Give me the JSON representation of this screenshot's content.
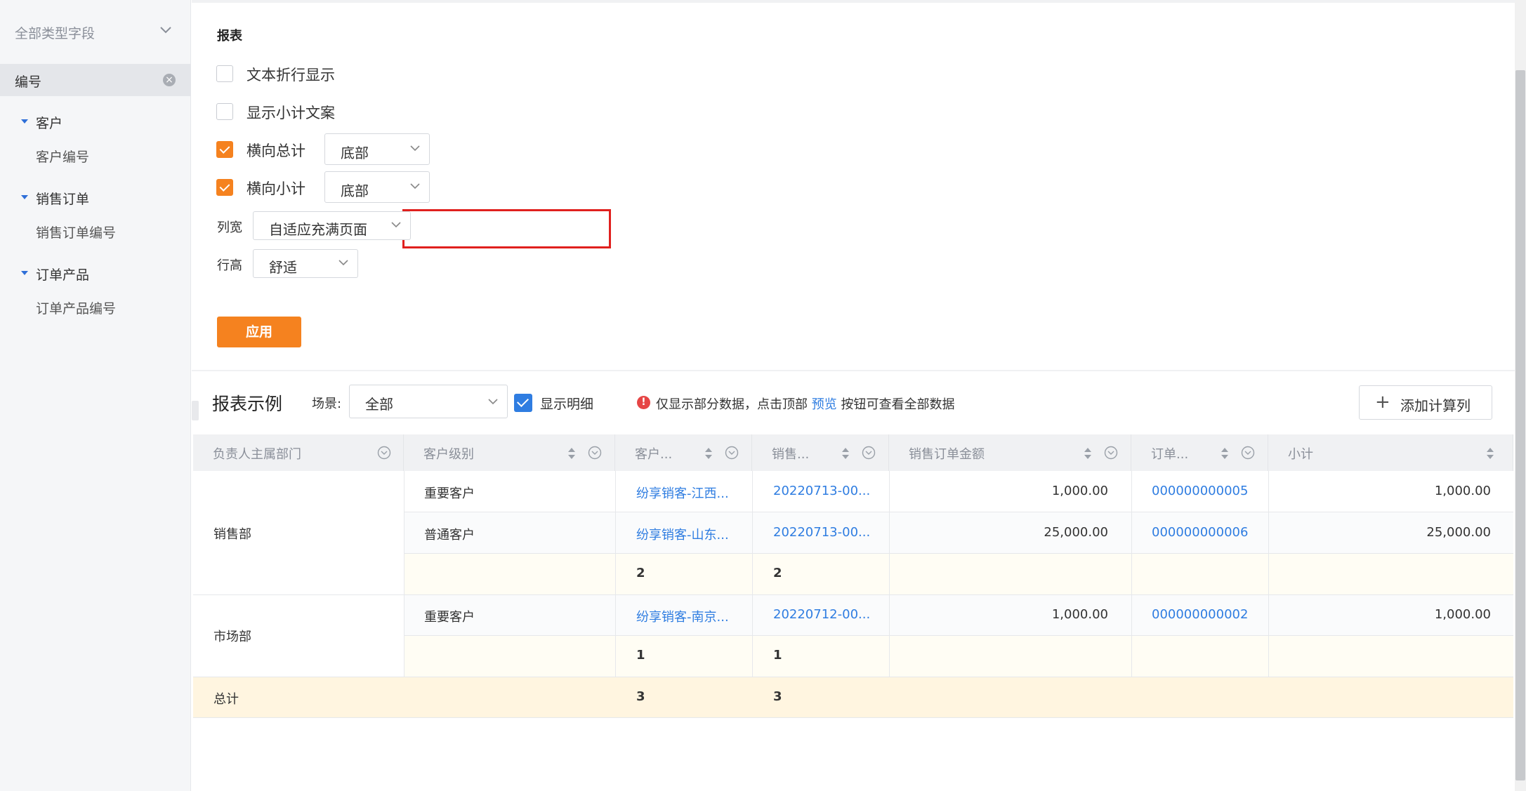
{
  "sidebar": {
    "type_select": "全部类型字段",
    "selected_field": "编号",
    "groups": [
      {
        "label": "客户",
        "items": [
          "客户编号"
        ]
      },
      {
        "label": "销售订单",
        "items": [
          "销售订单编号"
        ]
      },
      {
        "label": "订单产品",
        "items": [
          "订单产品编号"
        ]
      }
    ]
  },
  "settings": {
    "title": "报表",
    "wrap_text": {
      "label": "文本折行显示",
      "checked": false
    },
    "show_subtotal_text": {
      "label": "显示小计文案",
      "checked": false
    },
    "horizontal_total": {
      "label": "横向总计",
      "checked": true,
      "value": "底部"
    },
    "horizontal_subtotal": {
      "label": "横向小计",
      "checked": true,
      "value": "底部"
    },
    "column_width": {
      "label": "列宽",
      "value": "自适应充满页面"
    },
    "row_height": {
      "label": "行高",
      "value": "舒适"
    },
    "apply_label": "应用"
  },
  "report": {
    "title": "报表示例",
    "scene_label": "场景:",
    "scene_value": "全部",
    "show_detail_label": "显示明细",
    "info_prefix": "仅显示部分数据，点击顶部",
    "info_link": "预览",
    "info_suffix": "按钮可查看全部数据",
    "add_column_label": "添加计算列",
    "columns": [
      "负责人主属部门",
      "客户级别",
      "客户...",
      "销售...",
      "销售订单金额",
      "订单...",
      "小计"
    ],
    "rows": [
      {
        "dept": "销售部",
        "level": "重要客户",
        "customer": "纷享销客-江西...",
        "order": "20220713-00...",
        "amount": "1,000.00",
        "product": "000000000005",
        "subtotal": "1,000.00"
      },
      {
        "dept": "",
        "level": "普通客户",
        "customer": "纷享销客-山东...",
        "order": "20220713-00...",
        "amount": "25,000.00",
        "product": "000000000006",
        "subtotal": "25,000.00"
      },
      {
        "dept": "",
        "level": "",
        "customer": "2",
        "order": "2",
        "amount": "",
        "product": "",
        "subtotal": ""
      },
      {
        "dept": "市场部",
        "level": "重要客户",
        "customer": "纷享销客-南京...",
        "order": "20220712-00...",
        "amount": "1,000.00",
        "product": "000000000002",
        "subtotal": "1,000.00"
      },
      {
        "dept": "",
        "level": "",
        "customer": "1",
        "order": "1",
        "amount": "",
        "product": "",
        "subtotal": ""
      }
    ],
    "total": {
      "label": "总计",
      "customer": "3",
      "order": "3"
    }
  },
  "colors": {
    "accent": "#f5821f",
    "link": "#2f7de1",
    "highlight": "#e0201e"
  }
}
